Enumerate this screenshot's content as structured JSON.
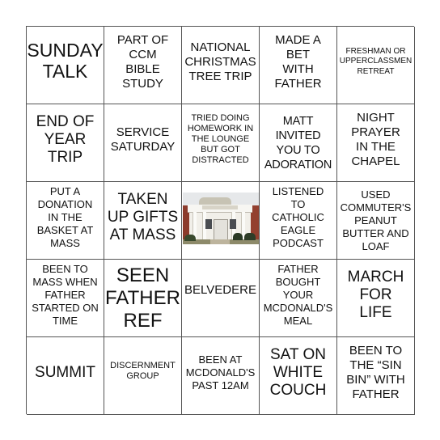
{
  "card": {
    "cells": [
      {
        "text": "SUNDAY\nTALK"
      },
      {
        "text": "PART OF\nCCM\nBIBLE\nSTUDY"
      },
      {
        "text": "NATIONAL\nCHRISTMAS\nTREE TRIP"
      },
      {
        "text": "MADE A\nBET\nWITH\nFATHER"
      },
      {
        "text": "FRESHMAN OR\nUPPERCLASSMEN\nRETREAT"
      },
      {
        "text": "END OF\nYEAR\nTRIP"
      },
      {
        "text": "SERVICE\nSATURDAY"
      },
      {
        "text": "TRIED DOING\nHOMEWORK IN\nTHE LOUNGE\nBUT GOT\nDISTRACTED"
      },
      {
        "text": "MATT\nINVITED\nYOU TO\nADORATION"
      },
      {
        "text": "NIGHT\nPRAYER\nIN THE\nCHAPEL"
      },
      {
        "text": "PUT A\nDONATION\nIN THE\nBASKET AT\nMASS"
      },
      {
        "text": "TAKEN\nUP GIFTS\nAT MASS"
      },
      {
        "text": "",
        "image": "building-photo",
        "free_space": true
      },
      {
        "text": "LISTENED\nTO\nCATHOLIC\nEAGLE\nPODCAST"
      },
      {
        "text": "USED\nCOMMUTER'S\nPEANUT\nBUTTER AND\nLOAF"
      },
      {
        "text": "BEEN TO\nMASS WHEN\nFATHER\nSTARTED ON\nTIME"
      },
      {
        "text": "SEEN\nFATHER\nREF"
      },
      {
        "text": "BELVEDERE"
      },
      {
        "text": "FATHER\nBOUGHT\nYOUR\nMCDONALD'S\nMEAL"
      },
      {
        "text": "MARCH\nFOR\nLIFE"
      },
      {
        "text": "SUMMIT"
      },
      {
        "text": "DISCERNMENT\nGROUP"
      },
      {
        "text": "BEEN AT\nMCDONALD'S\nPAST 12AM"
      },
      {
        "text": "SAT ON\nWHITE\nCOUCH"
      },
      {
        "text": "BEEN TO\nTHE “SIN\nBIN” WITH\nFATHER"
      }
    ]
  }
}
